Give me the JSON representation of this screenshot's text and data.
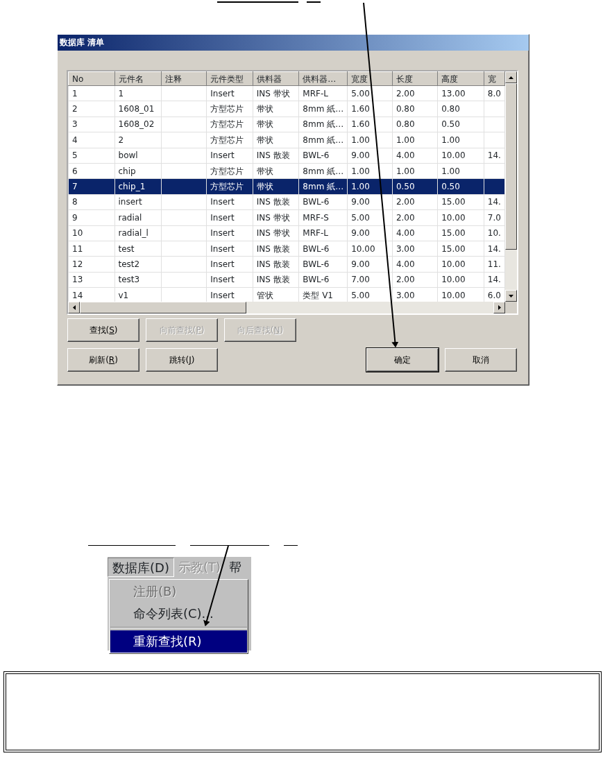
{
  "dialog": {
    "title": "数据库 清单",
    "columns": [
      "No",
      "元件名",
      "注释",
      "元件类型",
      "供料器",
      "供料器…",
      "宽度",
      "长度",
      "高度",
      "宽"
    ],
    "rows": [
      {
        "cells": [
          "1",
          "1",
          "",
          "Insert",
          "INS 带状",
          "MRF-L",
          "5.00",
          "2.00",
          "13.00",
          "8.0"
        ],
        "selected": false
      },
      {
        "cells": [
          "2",
          "1608_01",
          "",
          "方型芯片",
          "带状",
          "8mm 紙…",
          "1.60",
          "0.80",
          "0.80",
          ""
        ],
        "selected": false
      },
      {
        "cells": [
          "3",
          "1608_02",
          "",
          "方型芯片",
          "带状",
          "8mm 紙…",
          "1.60",
          "0.80",
          "0.50",
          ""
        ],
        "selected": false
      },
      {
        "cells": [
          "4",
          "2",
          "",
          "方型芯片",
          "带状",
          "8mm 紙…",
          "1.00",
          "1.00",
          "1.00",
          ""
        ],
        "selected": false
      },
      {
        "cells": [
          "5",
          "bowl",
          "",
          "Insert",
          "INS 散装",
          "BWL-6",
          "9.00",
          "4.00",
          "10.00",
          "14."
        ],
        "selected": false
      },
      {
        "cells": [
          "6",
          "chip",
          "",
          "方型芯片",
          "带状",
          "8mm 紙…",
          "1.00",
          "1.00",
          "1.00",
          ""
        ],
        "selected": false
      },
      {
        "cells": [
          "7",
          "chip_1",
          "",
          "方型芯片",
          "带状",
          "8mm 紙…",
          "1.00",
          "0.50",
          "0.50",
          ""
        ],
        "selected": true
      },
      {
        "cells": [
          "8",
          "insert",
          "",
          "Insert",
          "INS 散装",
          "BWL-6",
          "9.00",
          "2.00",
          "15.00",
          "14."
        ],
        "selected": false
      },
      {
        "cells": [
          "9",
          "radial",
          "",
          "Insert",
          "INS 带状",
          "MRF-S",
          "5.00",
          "2.00",
          "10.00",
          "7.0"
        ],
        "selected": false
      },
      {
        "cells": [
          "10",
          "radial_l",
          "",
          "Insert",
          "INS 带状",
          "MRF-L",
          "9.00",
          "4.00",
          "15.00",
          "10."
        ],
        "selected": false
      },
      {
        "cells": [
          "11",
          "test",
          "",
          "Insert",
          "INS 散装",
          "BWL-6",
          "10.00",
          "3.00",
          "15.00",
          "14."
        ],
        "selected": false
      },
      {
        "cells": [
          "12",
          "test2",
          "",
          "Insert",
          "INS 散装",
          "BWL-6",
          "9.00",
          "4.00",
          "10.00",
          "11."
        ],
        "selected": false
      },
      {
        "cells": [
          "13",
          "test3",
          "",
          "Insert",
          "INS 散装",
          "BWL-6",
          "7.00",
          "2.00",
          "10.00",
          "14."
        ],
        "selected": false
      },
      {
        "cells": [
          "14",
          "v1",
          "",
          "Insert",
          "管状",
          "类型 V1",
          "5.00",
          "3.00",
          "10.00",
          "6.0"
        ],
        "selected": false
      }
    ],
    "button_rows": [
      [
        {
          "before": "查找(",
          "mnemonic": "S",
          "after": ")",
          "disabled": false,
          "default": false
        },
        {
          "before": "向前查找(",
          "mnemonic": "P",
          "after": ")",
          "disabled": true,
          "default": false
        },
        {
          "before": "向后查找(",
          "mnemonic": "N",
          "after": ")",
          "disabled": true,
          "default": false
        }
      ],
      [
        {
          "before": "刷新(",
          "mnemonic": "R",
          "after": ")",
          "disabled": false,
          "default": false
        },
        {
          "before": "跳转(",
          "mnemonic": "J",
          "after": ")",
          "disabled": false,
          "default": false
        }
      ]
    ],
    "action_buttons": [
      {
        "label": "确定",
        "default": true
      },
      {
        "label": "取消",
        "default": false
      }
    ]
  },
  "menu": {
    "bar": [
      {
        "label": "数据库(D)",
        "open": true,
        "disabled": false
      },
      {
        "label": "示教(T)",
        "open": false,
        "disabled": true
      },
      {
        "label": "帮",
        "open": false,
        "disabled": false
      }
    ],
    "items": [
      {
        "kind": "item",
        "label": "注册(B)",
        "disabled": true,
        "selected": false
      },
      {
        "kind": "item",
        "label": "命令列表(C)...",
        "disabled": false,
        "selected": false
      },
      {
        "kind": "separator"
      },
      {
        "kind": "item",
        "label": "重新查找(R)",
        "disabled": false,
        "selected": true
      }
    ]
  }
}
